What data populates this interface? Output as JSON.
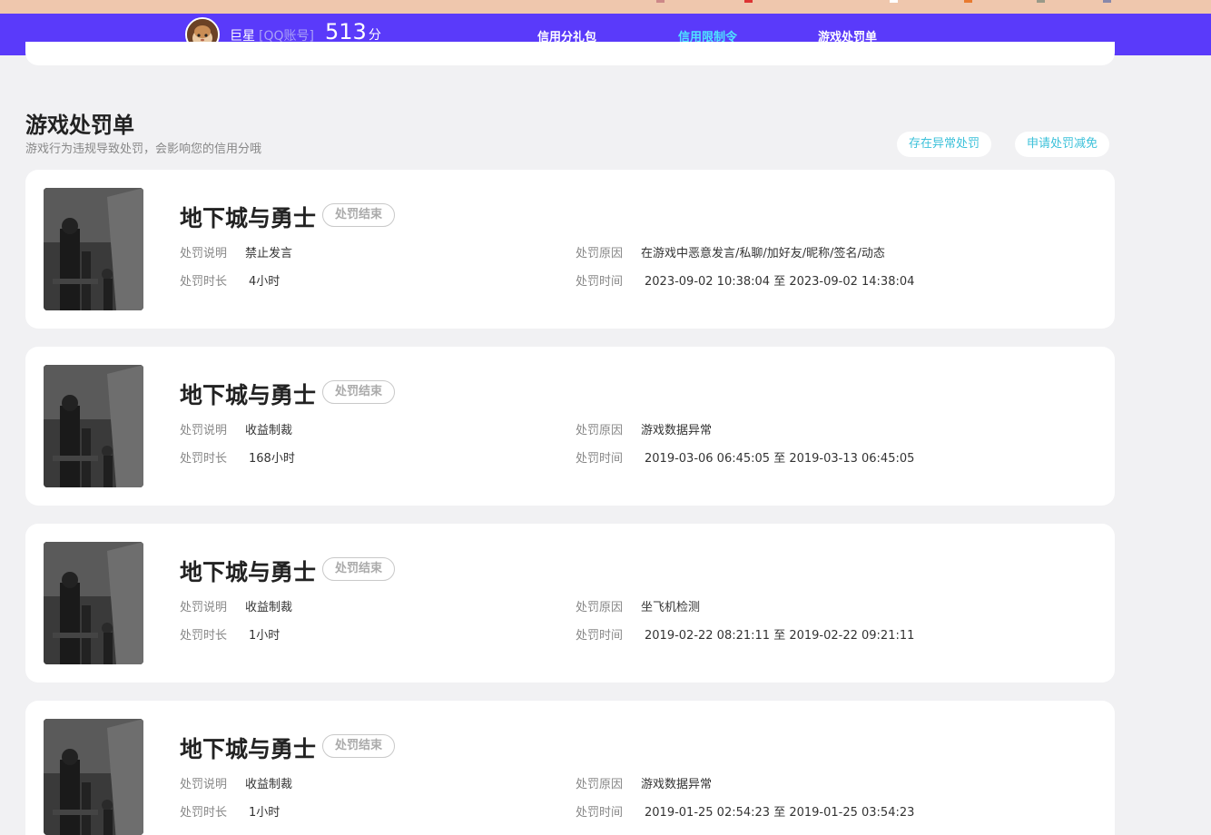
{
  "colors": {
    "nav_bg": "#5a3afa",
    "nav_active": "#4fe4ff",
    "accent_button": "#3cc1da",
    "page_bg": "#f1f1f3"
  },
  "user": {
    "name": "巨星",
    "account_type": "[QQ账号]",
    "score": "513",
    "score_unit": "分",
    "avatar_icon": "user-avatar"
  },
  "nav": {
    "tabs": [
      {
        "label": "信用分礼包",
        "active": false
      },
      {
        "label": "信用限制令",
        "active": true
      },
      {
        "label": "游戏处罚单",
        "active": false
      }
    ]
  },
  "section": {
    "title": "游戏处罚单",
    "subtitle": "游戏行为违规导致处罚，会影响您的信用分哦",
    "buttons": {
      "abnormal": "存在异常处罚",
      "appeal": "申请处罚减免"
    }
  },
  "labels": {
    "desc": "处罚说明",
    "reason": "处罚原因",
    "duration": "处罚时长",
    "time": "处罚时间"
  },
  "records": [
    {
      "game": "地下城与勇士",
      "status": "处罚结束",
      "desc": "禁止发言",
      "reason": "在游戏中恶意发言/私聊/加好友/昵称/签名/动态",
      "duration": "4小时",
      "time": "2023-09-02 10:38:04 至 2023-09-02 14:38:04"
    },
    {
      "game": "地下城与勇士",
      "status": "处罚结束",
      "desc": "收益制裁",
      "reason": "游戏数据异常",
      "duration": "168小时",
      "time": "2019-03-06 06:45:05 至 2019-03-13 06:45:05"
    },
    {
      "game": "地下城与勇士",
      "status": "处罚结束",
      "desc": "收益制裁",
      "reason": "坐飞机检测",
      "duration": "1小时",
      "time": "2019-02-22 08:21:11 至 2019-02-22 09:21:11"
    },
    {
      "game": "地下城与勇士",
      "status": "处罚结束",
      "desc": "收益制裁",
      "reason": "游戏数据异常",
      "duration": "1小时",
      "time": "2019-01-25 02:54:23 至 2019-01-25 03:54:23"
    }
  ]
}
